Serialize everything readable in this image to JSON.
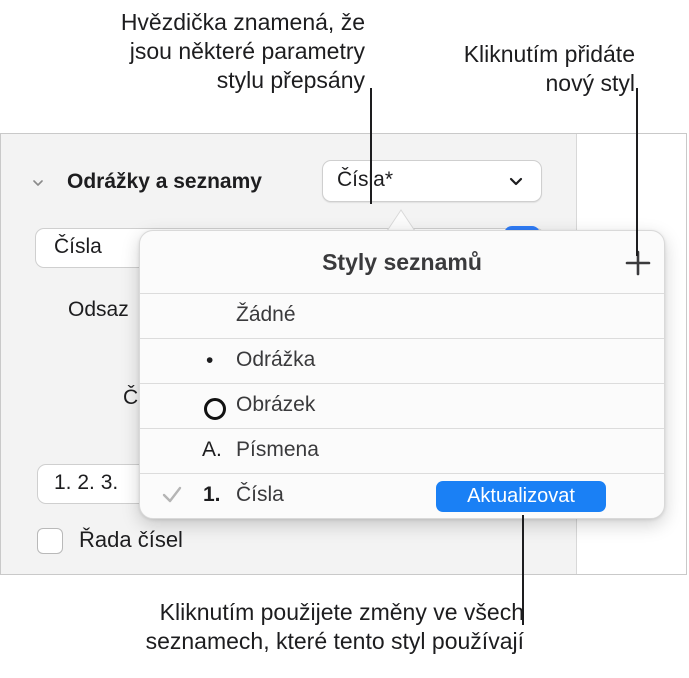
{
  "callouts": {
    "asterisk_line1": "Hvězdička znamená, že",
    "asterisk_line2": "jsou některé parametry",
    "asterisk_line3": "stylu přepsány",
    "add_line1": "Kliknutím přidáte",
    "add_line2": "nový styl",
    "update_line1": "Kliknutím použijete změny ve všech",
    "update_line2": "seznamech, které tento styl používají"
  },
  "inspector": {
    "section_title": "Odrážky a seznamy",
    "style_popup_value": "Čísla*",
    "list_type_value": "Čísla",
    "indent_label_partial": "Odsaz",
    "partial_label": "Č",
    "numbering_value": "1. 2. 3.",
    "tiered_numbers_label": "Řada čísel",
    "tiered_numbers_checked": false
  },
  "popover": {
    "title": "Styly seznamů",
    "add_icon": "plus-icon",
    "rows": [
      {
        "marker": "",
        "label": "Žádné"
      },
      {
        "marker": "•",
        "label": "Odrážka"
      },
      {
        "marker": "circle-image",
        "label": "Obrázek"
      },
      {
        "marker": "A.",
        "label": "Písmena"
      },
      {
        "marker": "1.",
        "label": "Čísla",
        "selected": true
      }
    ],
    "update_button": "Aktualizovat"
  },
  "colors": {
    "accent": "#1a80f5",
    "panel_bg": "#f3f3f3",
    "check": "#b5b5b5"
  }
}
